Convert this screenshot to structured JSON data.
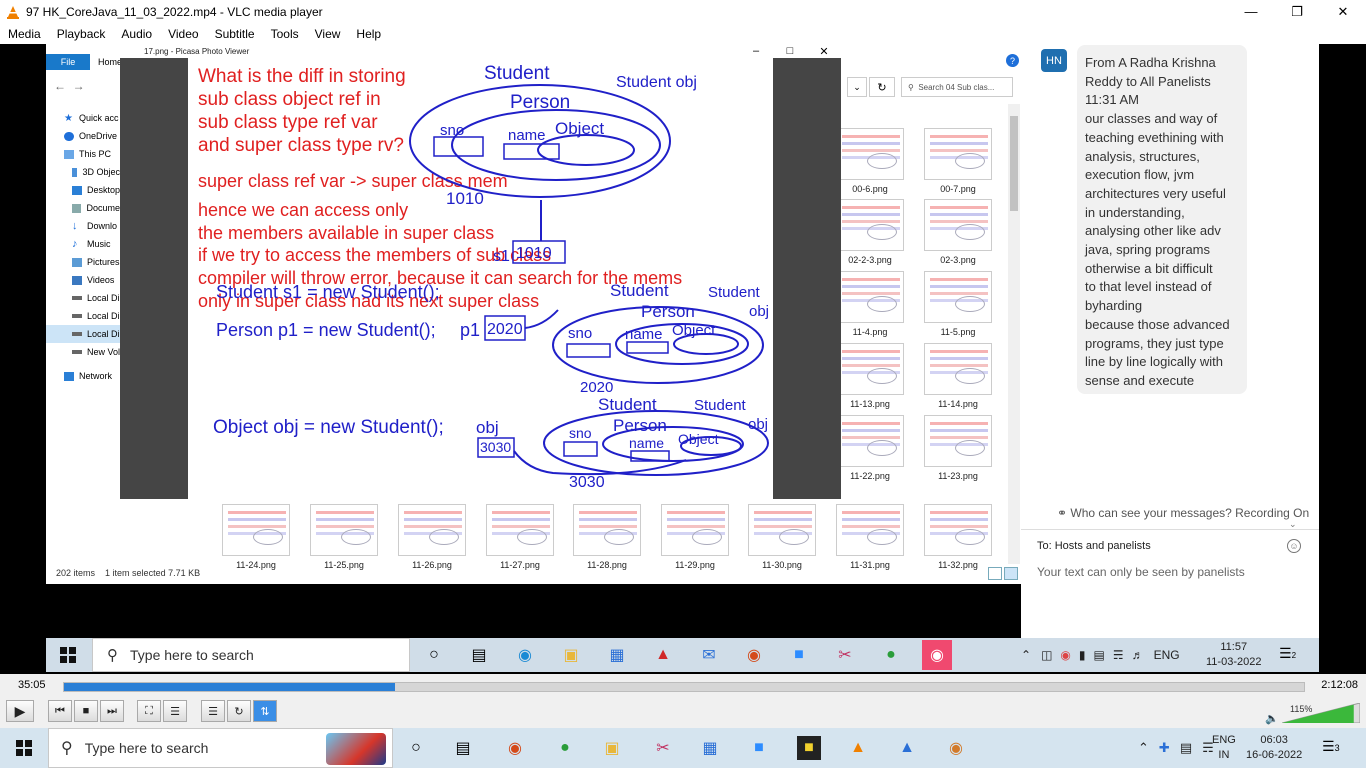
{
  "window": {
    "title": "97 HK_CoreJava_11_03_2022.mp4 - VLC media player",
    "menu": [
      "Media",
      "Playback",
      "Audio",
      "Video",
      "Subtitle",
      "Tools",
      "View",
      "Help"
    ]
  },
  "explorer": {
    "file_tab": "File",
    "home_tab": "Home",
    "search_placeholder": "Search 04 Sub clas...",
    "nav_items": [
      {
        "label": "Quick acc",
        "icon": "star-icon"
      },
      {
        "label": "OneDrive",
        "icon": "cloud-icon"
      },
      {
        "label": "This PC",
        "icon": "computer-icon"
      },
      {
        "label": "3D Objec",
        "icon": "cube-icon"
      },
      {
        "label": "Desktop",
        "icon": "desktop-icon"
      },
      {
        "label": "Docume",
        "icon": "document-icon"
      },
      {
        "label": "Downlo",
        "icon": "download-icon"
      },
      {
        "label": "Music",
        "icon": "music-icon"
      },
      {
        "label": "Pictures",
        "icon": "pictures-icon"
      },
      {
        "label": "Videos",
        "icon": "videos-icon"
      },
      {
        "label": "Local Di",
        "icon": "drive-icon"
      },
      {
        "label": "Local Di",
        "icon": "drive-icon"
      },
      {
        "label": "Local Di",
        "icon": "drive-icon"
      },
      {
        "label": "New Vol",
        "icon": "drive-icon"
      },
      {
        "label": "Network",
        "icon": "network-icon"
      }
    ],
    "right_thumbs": [
      "00-6.png",
      "00-7.png",
      "02-2-3.png",
      "02-3.png",
      "11-4.png",
      "11-5.png",
      "11-13.png",
      "11-14.png",
      "11-22.png",
      "11-23.png"
    ],
    "bottom_thumbs": [
      "11-24.png",
      "11-25.png",
      "11-26.png",
      "11-27.png",
      "11-28.png",
      "11-29.png",
      "11-30.png",
      "11-31.png",
      "11-32.png"
    ],
    "status_items": "202 items",
    "status_selected": "1 item selected  7.71 KB"
  },
  "picasa": {
    "title": "17.png - Picasa Photo Viewer",
    "slide": {
      "question": [
        "What is the diff in storing",
        "sub class object ref in",
        "sub class type ref var",
        "and super class type rv?"
      ],
      "statement": "super class ref var -> super class mem",
      "explanation": [
        "hence we can access only",
        "the members available in super class",
        "if we try to access the members of sub class",
        "compiler will throw error, because it can search for the mems",
        "only in super class nad its next super class"
      ],
      "code_line_1": "Student s1 = new Student();",
      "code_line_2": "Person p1 = new Student();",
      "code_line_3": "Object obj = new Student();",
      "ref_p1": "p1",
      "ref_obj": "obj",
      "ref_s1": "s1",
      "addr_1": "1010",
      "addr_2": "2020",
      "addr_3": "3030",
      "student": "Student",
      "person": "Person",
      "object": "Object",
      "sno": "sno",
      "name": "name",
      "student_obj": "Student obj",
      "obj": "obj"
    }
  },
  "chat": {
    "avatar": "HN",
    "message": "From A Radha Krishna\nReddy to All Panelists\n11:31 AM\nour classes and way of\nteaching evethining with\nanalysis, structures,\nexecution flow, jvm\narchitectures very useful\nin understanding,\nanalysing other like adv\njava, spring programs\notherwise a bit difficult\nto that level instead of\nbyharding\nbecause those advanced\nprograms, they just type\nline by line logically with\nsense and execute",
    "recording_note": "Who can see your messages? Recording On",
    "to_label": "To:  Hosts and panelists",
    "input_hint": "Your text can only be seen by panelists"
  },
  "inner_taskbar": {
    "search_placeholder": "Type here to search",
    "lang": "ENG",
    "time": "11:57",
    "date": "11-03-2022",
    "notif_count": "2"
  },
  "player": {
    "elapsed": "35:05",
    "total": "2:12:08",
    "progress": 0.267,
    "volume_label": "115%",
    "volume": 1.15
  },
  "taskbar": {
    "search_placeholder": "Type here to search",
    "lang_top": "ENG",
    "lang_bottom": "IN",
    "time": "06:03",
    "date": "16-06-2022",
    "notif_count": "3"
  }
}
